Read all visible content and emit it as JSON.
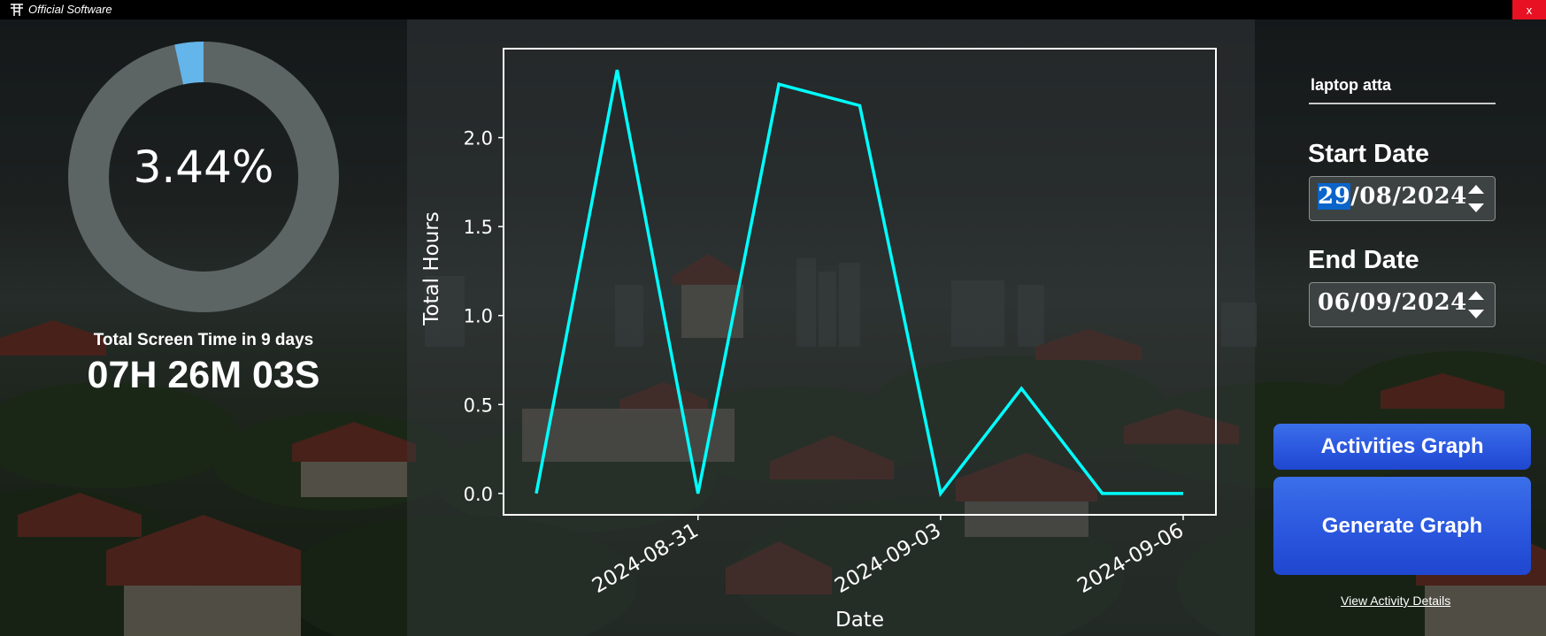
{
  "window": {
    "title": "Official Software",
    "close_label": "x"
  },
  "summary": {
    "percent_label": "3.44%",
    "percent_value": 0.0344,
    "screen_time_label": "Total Screen Time in 9 days",
    "screen_time_value": "07H 26M 03S"
  },
  "user": {
    "name": "laptop atta"
  },
  "start_date": {
    "label": "Start Date",
    "day": "29",
    "month": "08",
    "year": "2024"
  },
  "end_date": {
    "label": "End Date",
    "day": "06",
    "month": "09",
    "year": "2024"
  },
  "buttons": {
    "activities_graph": "Activities Graph",
    "generate_graph": "Generate Graph",
    "view_details": "View Activity Details"
  },
  "colors": {
    "line": "#00ffff",
    "donut_track": "#5d6464",
    "donut_fill": "#63b5ea",
    "button": "#2a55dd"
  },
  "chart_data": {
    "type": "line",
    "xlabel": "Date",
    "ylabel": "Total Hours",
    "x": [
      "2024-08-29",
      "2024-08-30",
      "2024-08-31",
      "2024-09-01",
      "2024-09-02",
      "2024-09-03",
      "2024-09-04",
      "2024-09-05",
      "2024-09-06"
    ],
    "xticks": [
      "2024-08-31",
      "2024-09-03",
      "2024-09-06"
    ],
    "yticks": [
      "0.0",
      "0.5",
      "1.0",
      "1.5",
      "2.0"
    ],
    "ylim": [
      -0.12,
      2.5
    ],
    "series": [
      {
        "values": [
          0.0,
          2.38,
          0.0,
          2.3,
          2.18,
          0.0,
          0.59,
          0.0,
          0.0
        ]
      }
    ],
    "grid": false,
    "legend": "none"
  }
}
